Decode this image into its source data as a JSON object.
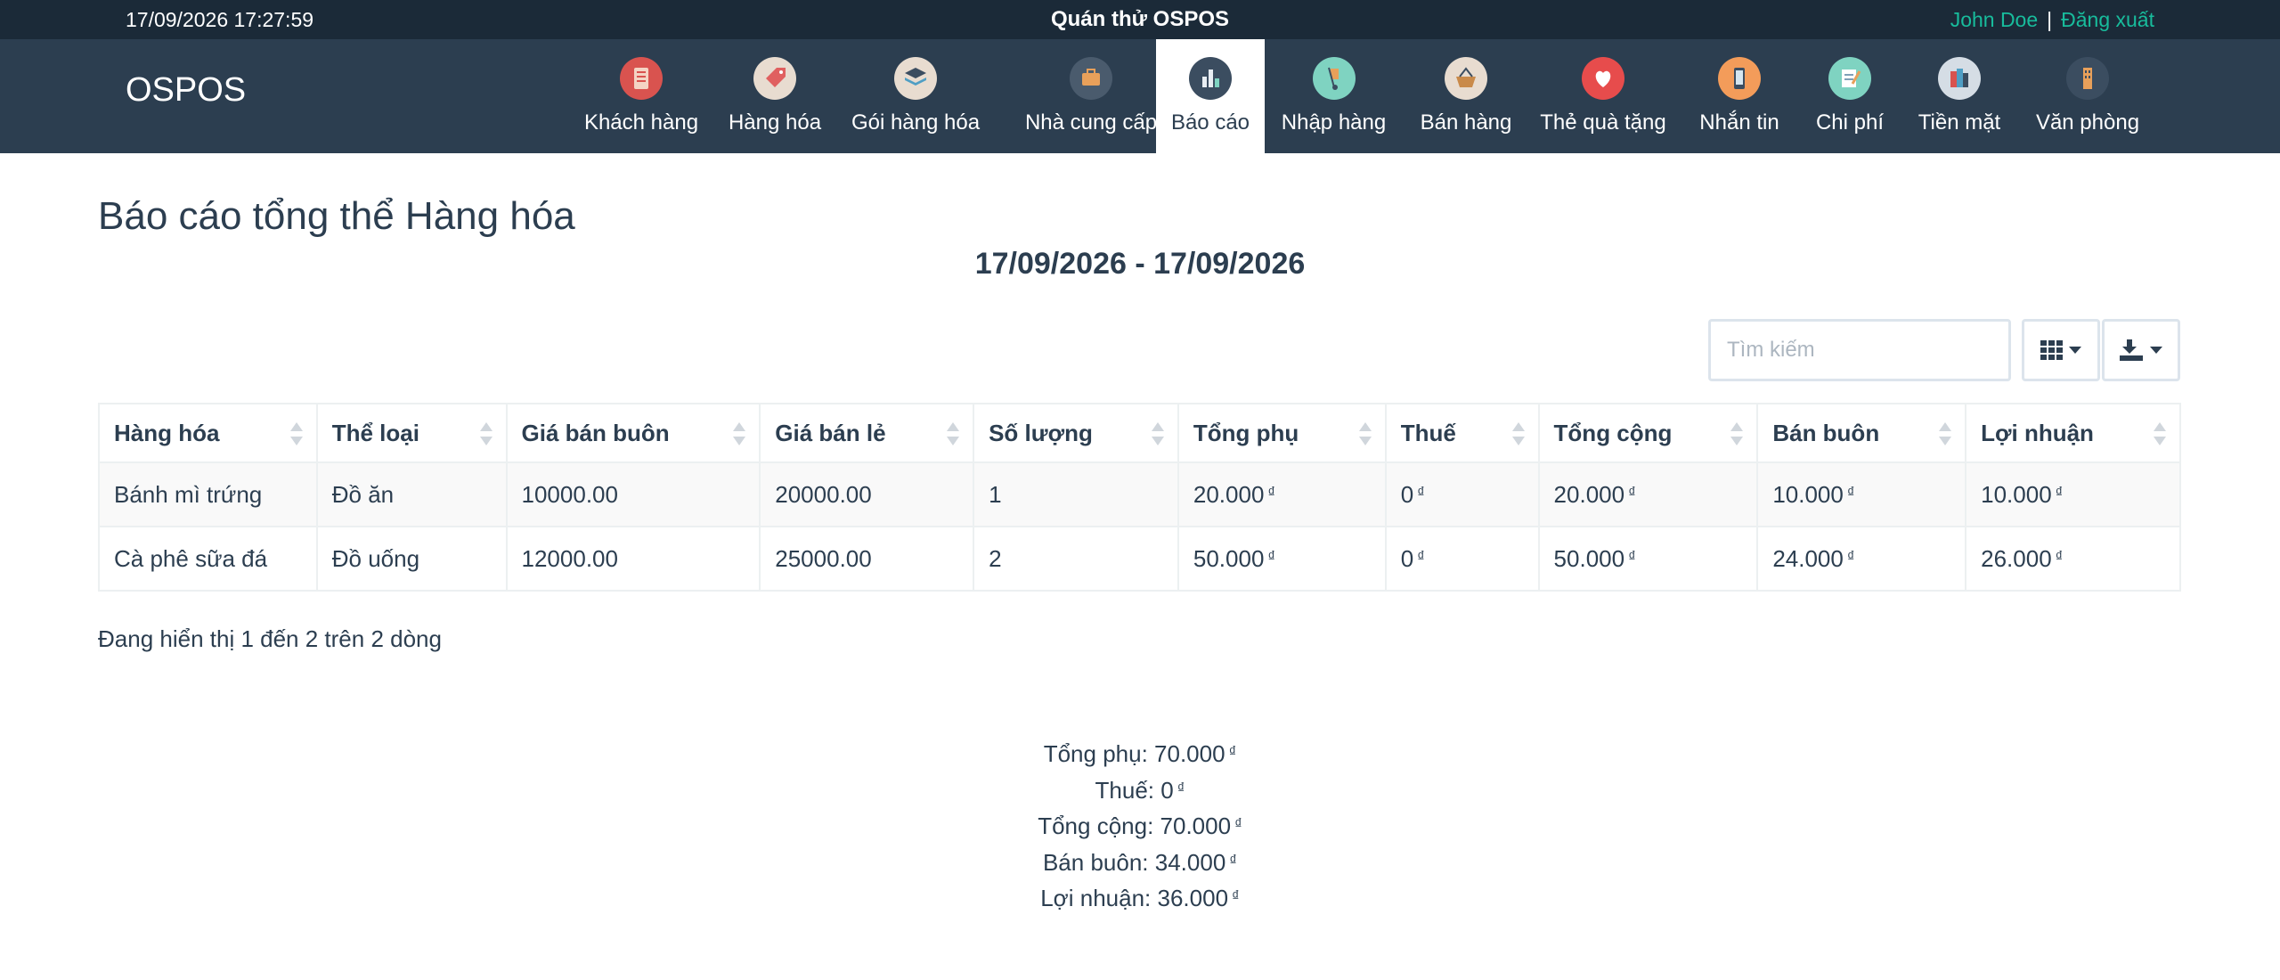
{
  "topbar": {
    "datetime": "17/09/2026 17:27:59",
    "store_name": "Quán thử OSPOS",
    "user_name": "John Doe",
    "separator": "|",
    "logout": "Đăng xuất"
  },
  "navbar": {
    "brand": "OSPOS",
    "items": [
      {
        "label": "Khách hàng",
        "icon": "customers-icon",
        "color": "#d9534f"
      },
      {
        "label": "Hàng hóa",
        "icon": "price-tag-icon",
        "color": "#e8dcd0"
      },
      {
        "label": "Gói hàng hóa",
        "icon": "layers-icon",
        "color": "#e8dcd0"
      },
      {
        "label": "Nhà cung cấp",
        "icon": "briefcase-icon",
        "color": "#4a5b6d"
      },
      {
        "label": "Báo cáo",
        "icon": "bar-chart-icon",
        "color": "#3b4d60"
      },
      {
        "label": "Nhập hàng",
        "icon": "hand-truck-icon",
        "color": "#7fd3c1"
      },
      {
        "label": "Bán hàng",
        "icon": "basket-icon",
        "color": "#e8dcd0"
      },
      {
        "label": "Thẻ quà tặng",
        "icon": "heart-icon",
        "color": "#e74c4c"
      },
      {
        "label": "Nhắn tin",
        "icon": "phone-icon",
        "color": "#f39c5a"
      },
      {
        "label": "Chi phí",
        "icon": "notepad-icon",
        "color": "#7fd3c1"
      },
      {
        "label": "Tiền mặt",
        "icon": "books-icon",
        "color": "#d5dde5"
      },
      {
        "label": "Văn phòng",
        "icon": "office-icon",
        "color": "#3b4d60"
      }
    ],
    "active_index": 4
  },
  "page": {
    "title": "Báo cáo tổng thể Hàng hóa",
    "date_range": "17/09/2026 - 17/09/2026"
  },
  "toolbar": {
    "search_placeholder": "Tìm kiếm",
    "columns_icon": "grid-icon",
    "export_icon": "download-icon"
  },
  "table": {
    "currency": "₫",
    "columns": [
      "Hàng hóa",
      "Thể loại",
      "Giá bán buôn",
      "Giá bán lẻ",
      "Số lượng",
      "Tổng phụ",
      "Thuế",
      "Tổng cộng",
      "Bán buôn",
      "Lợi nhuận"
    ],
    "rows": [
      [
        "Bánh mì trứng",
        "Đồ ăn",
        "10000.00",
        "20000.00",
        "1",
        "20.000",
        "0",
        "20.000",
        "10.000",
        "10.000"
      ],
      [
        "Cà phê sữa đá",
        "Đồ uống",
        "12000.00",
        "25000.00",
        "2",
        "50.000",
        "0",
        "50.000",
        "24.000",
        "26.000"
      ]
    ],
    "currency_columns": [
      5,
      6,
      7,
      8,
      9
    ]
  },
  "pagination": {
    "showing": "Đang hiển thị 1 đến 2 trên 2 dòng"
  },
  "summary": [
    {
      "label": "Tổng phụ:",
      "value": "70.000"
    },
    {
      "label": "Thuế:",
      "value": "0"
    },
    {
      "label": "Tổng cộng:",
      "value": "70.000"
    },
    {
      "label": "Bán buôn:",
      "value": "34.000"
    },
    {
      "label": "Lợi nhuận:",
      "value": "36.000"
    }
  ]
}
